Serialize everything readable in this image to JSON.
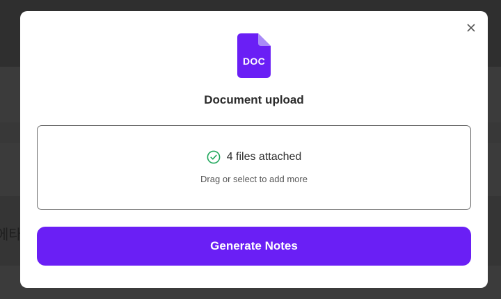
{
  "background": {
    "partial_text": "에타"
  },
  "modal": {
    "close_icon": "close-icon",
    "doc_icon": {
      "name": "document-icon",
      "label": "DOC",
      "color": "#6a1ff5",
      "fold_color": "#a98bf7"
    },
    "title": "Document upload",
    "dropzone": {
      "status_icon": "check-circle-icon",
      "status_color": "#1fa75b",
      "status_text": "4 files attached",
      "hint": "Drag or select to add more"
    },
    "generate_button": {
      "label": "Generate Notes",
      "color": "#6a1ff5"
    }
  }
}
